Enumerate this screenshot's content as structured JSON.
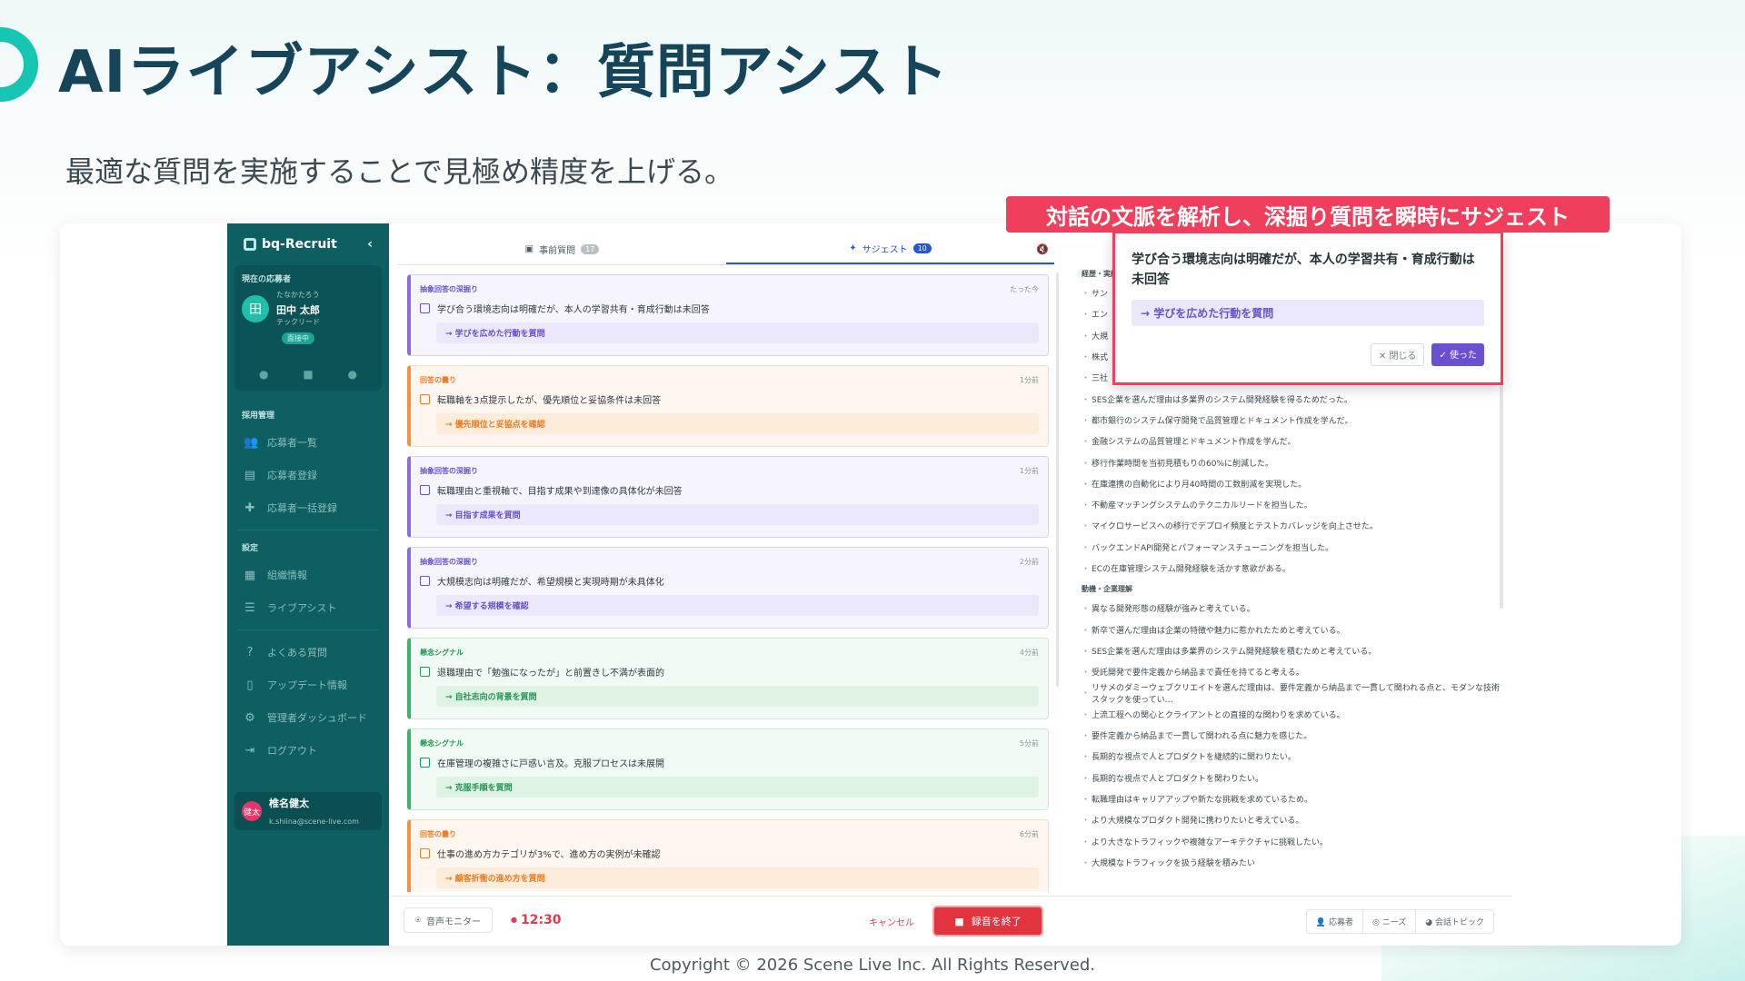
{
  "page": {
    "title": "AIライブアシスト：質問アシスト",
    "subtitle": "最適な質問を実施することで見極め精度を上げる。",
    "callout": "対話の文脈を解析し、深掘り質問を瞬時にサジェスト",
    "copyright": "Copyright © 2026 Scene Live Inc. All Rights Reserved."
  },
  "sidebar": {
    "brand": "bq-Recruit",
    "collapse_icon": "chevron-left-icon",
    "current_label": "現在の応募者",
    "candidate": {
      "initial": "田",
      "kana": "たなかたろう",
      "name": "田中 太郎",
      "company": "テックリード",
      "status": "面接中"
    },
    "section_recruit": "採用管理",
    "recruit_items": [
      {
        "label": "応募者一覧",
        "icon": "people-icon"
      },
      {
        "label": "応募者登録",
        "icon": "document-icon"
      },
      {
        "label": "応募者一括登録",
        "icon": "person-add-icon"
      }
    ],
    "section_settings": "設定",
    "settings_items": [
      {
        "label": "組織情報",
        "icon": "building-icon"
      },
      {
        "label": "ライブアシスト",
        "icon": "sliders-icon"
      }
    ],
    "other_items": [
      {
        "label": "よくある質問",
        "icon": "help-icon"
      },
      {
        "label": "アップデート情報",
        "icon": "phone-icon"
      },
      {
        "label": "管理者ダッシュボード",
        "icon": "admin-icon"
      },
      {
        "label": "ログアウト",
        "icon": "logout-icon"
      }
    ],
    "user": {
      "initials": "健太",
      "name": "椎名健太",
      "email": "k.shiina@scene-live.com"
    }
  },
  "tabs": [
    {
      "label": "事前質問",
      "count": "17"
    },
    {
      "label": "サジェスト",
      "count": "10"
    }
  ],
  "suggestions": [
    {
      "color": "purple",
      "category": "抽象回答の深掘り",
      "time": "たった今",
      "text": "学び合う環境志向は明確だが、本人の学習共有・育成行動は未回答",
      "question": "→ 学びを広めた行動を質問"
    },
    {
      "color": "orange",
      "category": "回答の曇り",
      "time": "1分前",
      "text": "転職軸を3点提示したが、優先順位と妥協条件は未回答",
      "question": "→ 優先順位と妥協点を確認"
    },
    {
      "color": "purple",
      "category": "抽象回答の深掘り",
      "time": "1分前",
      "text": "転職理由と重視軸で、目指す成果や到達像の具体化が未回答",
      "question": "→ 目指す成果を質問"
    },
    {
      "color": "purple",
      "category": "抽象回答の深掘り",
      "time": "2分前",
      "text": "大規模志向は明確だが、希望規模と実現時期が未具体化",
      "question": "→ 希望する規模を確認"
    },
    {
      "color": "green",
      "category": "懸念シグナル",
      "time": "4分前",
      "text": "退職理由で「勉強になったが」と前置きし不満が表面的",
      "question": "→ 自社志向の背景を質問"
    },
    {
      "color": "green",
      "category": "懸念シグナル",
      "time": "5分前",
      "text": "在庫管理の複雑さに戸惑い言及。克服プロセスは未展開",
      "question": "→ 克服手順を質問"
    },
    {
      "color": "orange",
      "category": "回答の曇り",
      "time": "6分前",
      "text": "仕事の進め方カテゴリが3%で、進め方の実例が未確認",
      "question": "→ 顧客折衝の進め方を質問"
    }
  ],
  "right_panel": {
    "section1": "経歴・実績",
    "section1_items": [
      "サン",
      "エン",
      "大規",
      "株式",
      "三社",
      "SES企業を選んだ理由は多業界のシステム開発経験を得るためだった。",
      "都市銀行のシステム保守開発で品質管理とドキュメント作成を学んだ。",
      "金融システムの品質管理とドキュメント作成を学んだ。",
      "移行作業時間を当初見積もりの60%に削減した。",
      "在庫連携の自動化により月40時間の工数削減を実現した。",
      "不動産マッチングシステムのテクニカルリードを担当した。",
      "マイクロサービスへの移行でデプロイ頻度とテストカバレッジを向上させた。",
      "バックエンドAPI開発とパフォーマンスチューニングを担当した。",
      "ECの在庫管理システム開発経験を活かす意欲がある。"
    ],
    "section2": "動機・企業理解",
    "section2_items": [
      "異なる開発形態の経験が強みと考えている。",
      "新卒で選んだ理由は企業の特徴や魅力に惹かれたためと考えている。",
      "SES企業を選んだ理由は多業界のシステム開発経験を積むためと考えている。",
      "受託開発で要件定義から納品まで責任を持てると考える。",
      "リサメのダミーウェブクリエイトを選んだ理由は、要件定義から納品まで一貫して関われる点と、モダンな技術スタックを使ってい…",
      "上流工程への関心とクライアントとの直接的な関わりを求めている。",
      "要件定義から納品まで一貫して関われる点に魅力を感じた。",
      "長期的な視点で人とプロダクトを継続的に関わりたい。",
      "長期的な視点で人とプロダクトを関わりたい。",
      "転職理由はキャリアアップや新たな挑戦を求めているため。",
      "より大規模なプロダクト開発に携わりたいと考えている。",
      "より大きなトラフィックや複雑なアーキテクチャに挑戦したい。",
      "大規模なトラフィックを扱う経験を積みたい"
    ]
  },
  "popup": {
    "text": "学び合う環境志向は明確だが、本人の学習共有・育成行動は未回答",
    "question": "→ 学びを広めた行動を質問",
    "close_label": "閉じる",
    "used_label": "使った"
  },
  "bottom_bar": {
    "monitor_label": "音声モニター",
    "timer": "12:30",
    "cancel_label": "キャンセル",
    "stop_label": "録音を終了",
    "right_tabs": [
      "応募者",
      "ニーズ",
      "会話トピック"
    ]
  }
}
